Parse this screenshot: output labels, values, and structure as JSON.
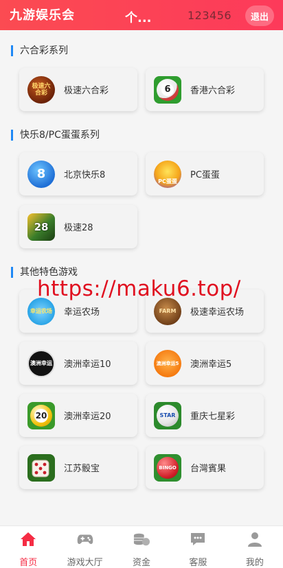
{
  "header": {
    "brand": "九游娱乐会",
    "user": "个...",
    "uid": "123456",
    "logout": "退出"
  },
  "sections": [
    {
      "title": "六合彩系列",
      "games": [
        {
          "label": "极速六合彩",
          "icon": "jisu-liuhecai-icon",
          "badge": "极速六合彩"
        },
        {
          "label": "香港六合彩",
          "icon": "hk-liuhecai-ball-icon",
          "badge": "6"
        }
      ]
    },
    {
      "title": "快乐8/PC蛋蛋系列",
      "games": [
        {
          "label": "北京快乐8",
          "icon": "beijing-kuaile8-icon",
          "badge": "8"
        },
        {
          "label": "PC蛋蛋",
          "icon": "pc-egg-chick-icon",
          "badge": "PC蛋蛋"
        },
        {
          "label": "极速28",
          "icon": "jisu28-icon",
          "badge": "28"
        }
      ]
    },
    {
      "title": "其他特色游戏",
      "games": [
        {
          "label": "幸运农场",
          "icon": "lucky-farm-icon",
          "badge": "幸运农场"
        },
        {
          "label": "极速幸运农场",
          "icon": "jisu-lucky-farm-icon",
          "badge": "FARM"
        },
        {
          "label": "澳洲幸运10",
          "icon": "au-lucky10-icon",
          "badge": "澳洲幸运"
        },
        {
          "label": "澳洲幸运5",
          "icon": "au-lucky5-icon",
          "badge": "澳洲幸运5"
        },
        {
          "label": "澳洲幸运20",
          "icon": "au-lucky20-ball-icon",
          "badge": "20"
        },
        {
          "label": "重庆七星彩",
          "icon": "cq-star-ball-icon",
          "badge": "STAR"
        },
        {
          "label": "江苏骰宝",
          "icon": "dice-icon",
          "badge": ""
        },
        {
          "label": "台灣賓果",
          "icon": "taiwan-bingo-icon",
          "badge": "BINGO"
        }
      ]
    }
  ],
  "watermark": "https://maku6.top/",
  "tabbar": [
    {
      "label": "首页",
      "icon": "home-icon",
      "active": true
    },
    {
      "label": "游戏大厅",
      "icon": "gamepad-icon",
      "active": false
    },
    {
      "label": "资金",
      "icon": "coins-icon",
      "active": false
    },
    {
      "label": "客服",
      "icon": "chat-icon",
      "active": false
    },
    {
      "label": "我的",
      "icon": "user-icon",
      "active": false
    }
  ],
  "colors": {
    "header_gradient": [
      "#fb4b52",
      "#fd3a5a"
    ],
    "accent_bar": "#1e88f5",
    "tab_active": "#f52c44",
    "watermark": "#e01020"
  }
}
